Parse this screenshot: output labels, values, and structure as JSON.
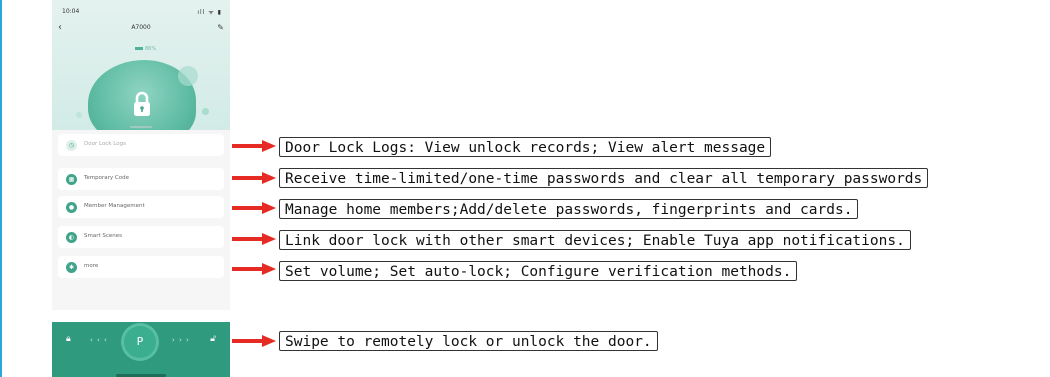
{
  "phone": {
    "status_time": "10:04",
    "status_icons": "ıll ᯤ ▮",
    "nav_back": "‹",
    "device_title": "A7000",
    "nav_edit": "✎",
    "battery_text": "86%",
    "menu": [
      {
        "icon": "clock-icon",
        "glyph": "◷",
        "label": "Door Lock Logs",
        "faint": true
      },
      {
        "icon": "grid-icon",
        "glyph": "▦",
        "label": "Temporary Code",
        "faint": false
      },
      {
        "icon": "person-icon",
        "glyph": "●",
        "label": "Member Management",
        "faint": false
      },
      {
        "icon": "scene-icon",
        "glyph": "◐",
        "label": "Smart Scenes",
        "faint": false
      },
      {
        "icon": "gear-icon",
        "glyph": "✱",
        "label": "more",
        "faint": false
      }
    ],
    "swipe_knob_glyph": "P",
    "chevrons_left": "‹ ‹ ‹",
    "chevrons_right": "› › ›"
  },
  "callouts": [
    "Door Lock Logs: View unlock records; View alert message",
    "Receive time-limited/one-time passwords and clear all temporary passwords",
    "Manage home members;Add/delete passwords, fingerprints and cards.",
    "Link door lock with other smart devices; Enable Tuya app notifications.",
    "Set volume; Set auto-lock; Configure verification methods.",
    "Swipe to remotely lock or unlock the door."
  ],
  "colors": {
    "accent": "#2f9a7d",
    "arrow": "#e62a24",
    "left_rule": "#2aa7d6"
  }
}
